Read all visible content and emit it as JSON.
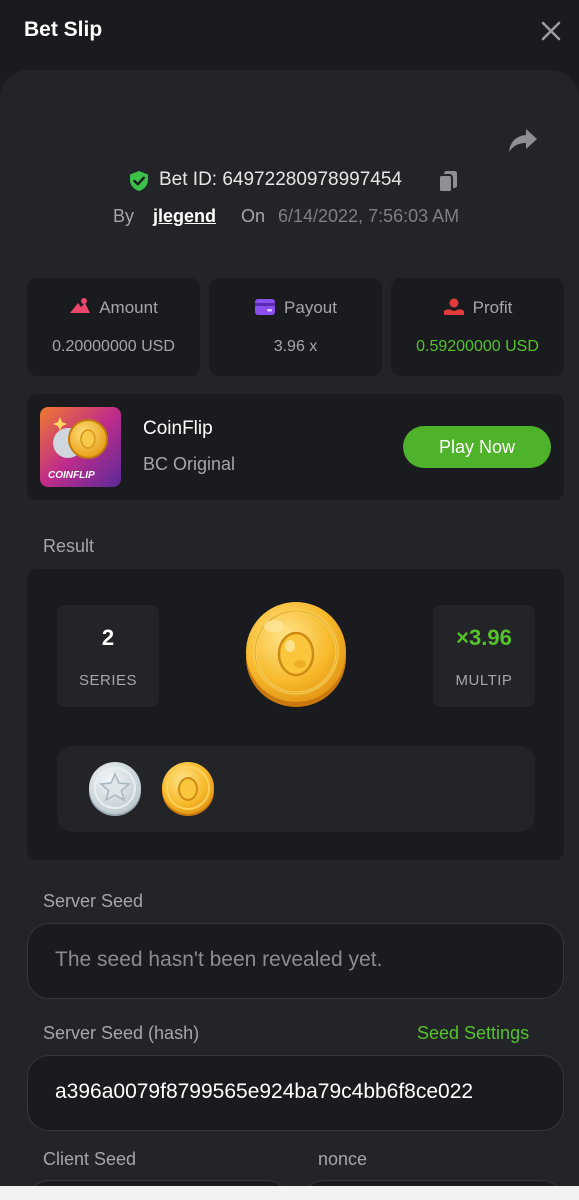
{
  "header": {
    "title": "Bet Slip"
  },
  "bet": {
    "id_text": "Bet ID: 64972280978997454",
    "by_label": "By",
    "user": "jlegend",
    "on_label": "On",
    "date": "6/14/2022, 7:56:03 AM"
  },
  "stats": [
    {
      "label": "Amount",
      "value": "0.20000000 USD",
      "icon": "amount-icon",
      "icon_color": "#e8476b"
    },
    {
      "label": "Payout",
      "value": "3.96 x",
      "icon": "wallet-icon",
      "icon_color": "#8b4ff0"
    },
    {
      "label": "Profit",
      "value": "0.59200000 USD",
      "icon": "profit-icon",
      "icon_color": "#e23b3b"
    }
  ],
  "game": {
    "thumb_text": "COINFLIP",
    "name": "CoinFlip",
    "subtitle": "BC Original",
    "play_label": "Play Now"
  },
  "result": {
    "label": "Result",
    "series_value": "2",
    "series_label": "SERIES",
    "multip_value": "×3.96",
    "multip_label": "MULTIP",
    "history": [
      "silver-coin",
      "gold-coin"
    ]
  },
  "server_seed": {
    "label": "Server Seed",
    "value": "The seed hasn't been revealed yet."
  },
  "server_seed_hash": {
    "label": "Server Seed (hash)",
    "link": "Seed Settings",
    "value": "a396a0079f8799565e924ba79c4bb6f8ce022"
  },
  "client_seed": {
    "label": "Client Seed"
  },
  "nonce": {
    "label": "nonce"
  },
  "colors": {
    "accent_green": "#55c22b",
    "button_green": "#4fb22b",
    "background": "#1a1b1e",
    "panel": "#232428"
  }
}
